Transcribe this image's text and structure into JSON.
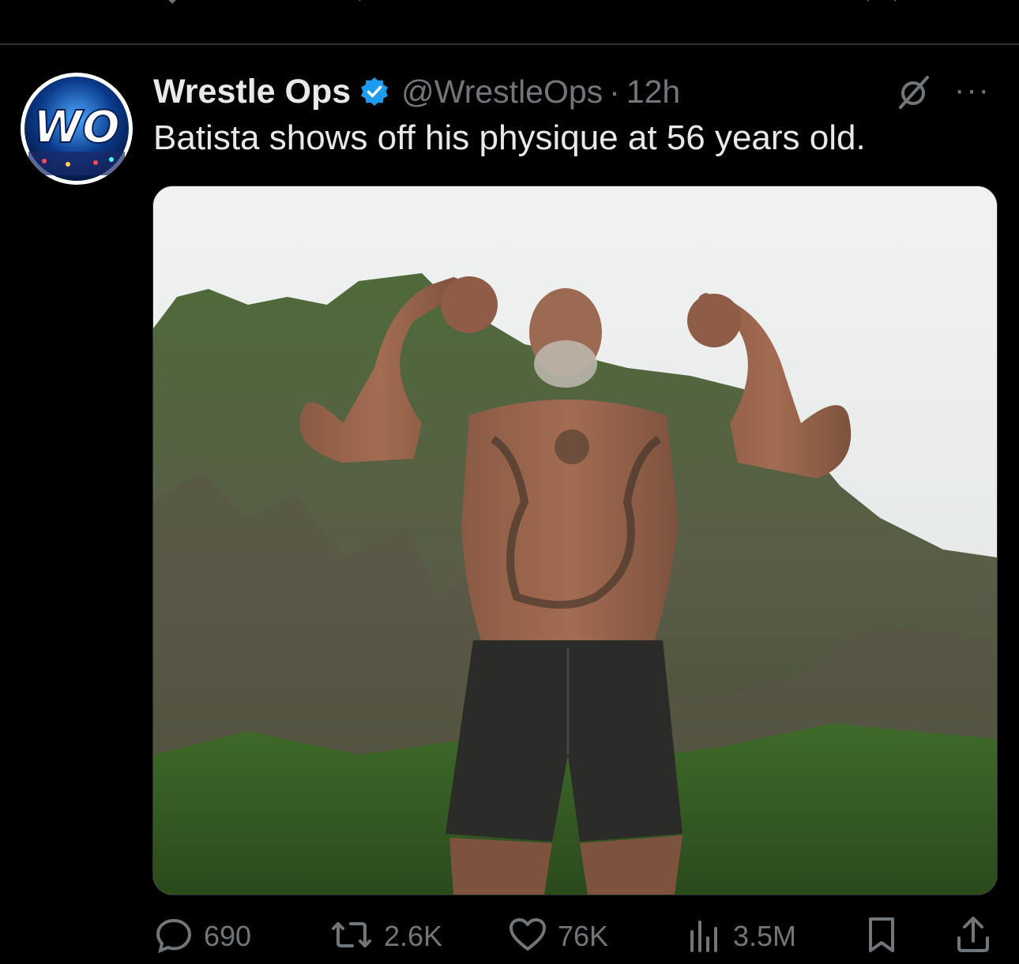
{
  "tweet": {
    "author_name": "Wrestle Ops",
    "handle": "@WrestleOps",
    "separator": "·",
    "time": "12h",
    "text": "Batista shows off his physique at 56 years old.",
    "avatar_text": "WO",
    "media_icon": "photo-image",
    "verified_icon": "verified-badge-icon",
    "grok_icon": "grok-icon",
    "more_icon": "more-icon",
    "more_label": "···"
  },
  "actions": {
    "replies": "690",
    "reposts": "2.6K",
    "likes": "76K",
    "views": "3.5M",
    "bookmark_icon": "bookmark-icon",
    "share_icon": "share-icon"
  },
  "colors": {
    "background": "#000000",
    "text": "#e7e9ea",
    "muted": "#71767b",
    "verified": "#1d9bf0",
    "divider": "#2f3336"
  }
}
